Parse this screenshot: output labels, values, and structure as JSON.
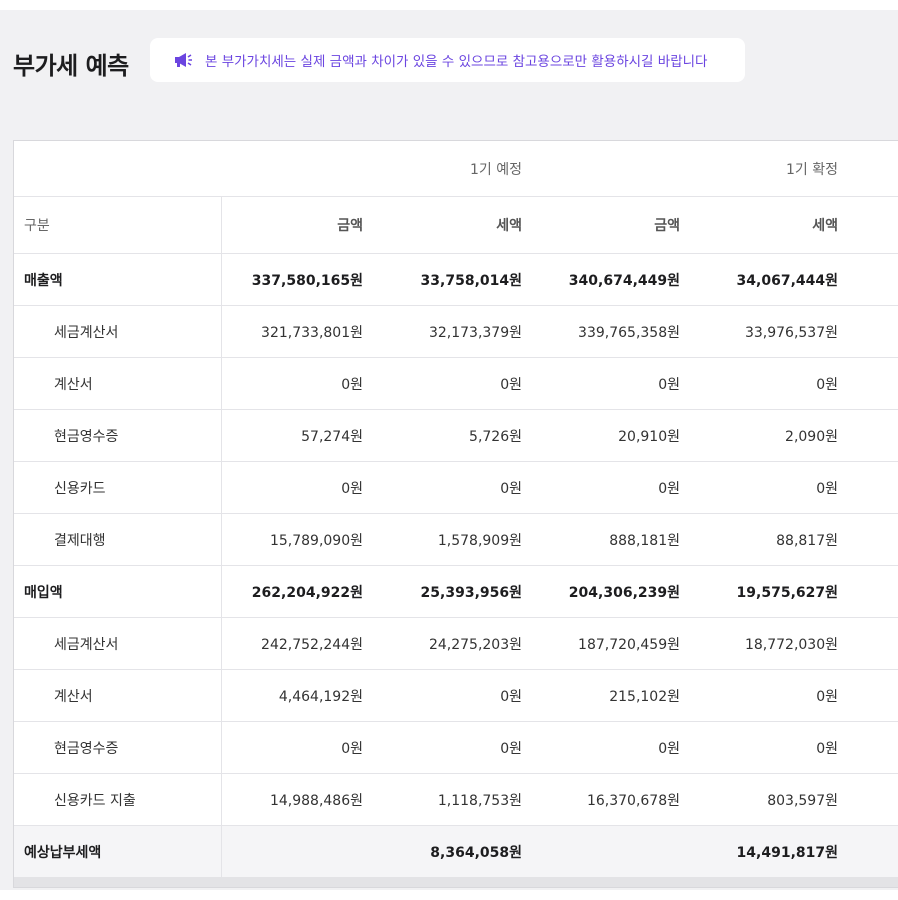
{
  "page": {
    "title": "부가세 예측",
    "notice_icon": "megaphone-icon",
    "notice": "본 부가가치세는 실제 금액과 차이가 있을 수 있으므로 참고용으로만 활용하시길 바랍니다",
    "accent_color": "#6b45e0"
  },
  "table": {
    "groups": [
      "1기 예정",
      "1기 확정"
    ],
    "columns": [
      "구분",
      "금액",
      "세액",
      "금액",
      "세액"
    ],
    "rows": [
      {
        "label": "매출액",
        "values": [
          "337,580,165원",
          "33,758,014원",
          "340,674,449원",
          "34,067,444원"
        ]
      },
      {
        "label": "세금계산서",
        "values": [
          "321,733,801원",
          "32,173,379원",
          "339,765,358원",
          "33,976,537원"
        ]
      },
      {
        "label": "계산서",
        "values": [
          "0원",
          "0원",
          "0원",
          "0원"
        ]
      },
      {
        "label": "현금영수증",
        "values": [
          "57,274원",
          "5,726원",
          "20,910원",
          "2,090원"
        ]
      },
      {
        "label": "신용카드",
        "values": [
          "0원",
          "0원",
          "0원",
          "0원"
        ]
      },
      {
        "label": "결제대행",
        "values": [
          "15,789,090원",
          "1,578,909원",
          "888,181원",
          "88,817원"
        ]
      },
      {
        "label": "매입액",
        "values": [
          "262,204,922원",
          "25,393,956원",
          "204,306,239원",
          "19,575,627원"
        ]
      },
      {
        "label": "세금계산서",
        "values": [
          "242,752,244원",
          "24,275,203원",
          "187,720,459원",
          "18,772,030원"
        ]
      },
      {
        "label": "계산서",
        "values": [
          "4,464,192원",
          "0원",
          "215,102원",
          "0원"
        ]
      },
      {
        "label": "현금영수증",
        "values": [
          "0원",
          "0원",
          "0원",
          "0원"
        ]
      },
      {
        "label": "신용카드 지출",
        "values": [
          "14,988,486원",
          "1,118,753원",
          "16,370,678원",
          "803,597원"
        ]
      }
    ],
    "total": {
      "label": "예상납부세액",
      "values": [
        "",
        "8,364,058원",
        "",
        "14,491,817원"
      ]
    }
  }
}
